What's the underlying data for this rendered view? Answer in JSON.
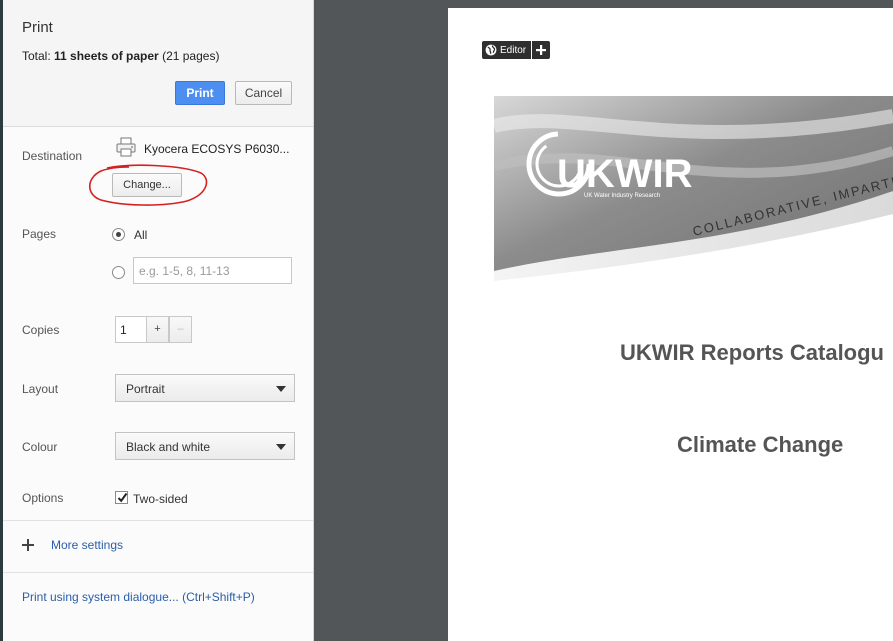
{
  "sidebar": {
    "title": "Print",
    "summary": {
      "prefix": "Total: ",
      "sheets": "11 sheets of paper",
      "suffix": " (21 pages)"
    },
    "print_button": "Print",
    "cancel_button": "Cancel",
    "destination": {
      "label": "Destination",
      "printer_name": "Kyocera ECOSYS P6030...",
      "change_button": "Change..."
    },
    "pages": {
      "label": "Pages",
      "all_label": "All",
      "range_placeholder": "e.g. 1-5, 8, 11-13",
      "selected": "all"
    },
    "copies": {
      "label": "Copies",
      "value": "1",
      "plus": "+",
      "minus": "–"
    },
    "layout": {
      "label": "Layout",
      "selected": "Portrait"
    },
    "colour": {
      "label": "Colour",
      "selected": "Black and white"
    },
    "options": {
      "label": "Options",
      "two_sided_label": "Two-sided",
      "two_sided_checked": true
    },
    "more_settings": "More settings",
    "system_dialog_link": "Print using system dialogue... (Ctrl+Shift+P)"
  },
  "preview": {
    "editor_badge": "Editor",
    "logo_text": "UKWIR",
    "logo_subtext": "UK Water Industry Research",
    "banner_slogan": "COLLABORATIVE, IMPARTI",
    "doc_title": "UKWIR Reports Catalogu",
    "doc_subtitle": "Climate Change"
  },
  "colors": {
    "accent": "#4d8ff0",
    "link": "#2b5ea8",
    "preview_background": "#525659",
    "annotation": "#d42020"
  },
  "icons": [
    "printer-icon",
    "plus-icon",
    "globe-icon",
    "checkmark-icon",
    "chevron-down-icon"
  ]
}
